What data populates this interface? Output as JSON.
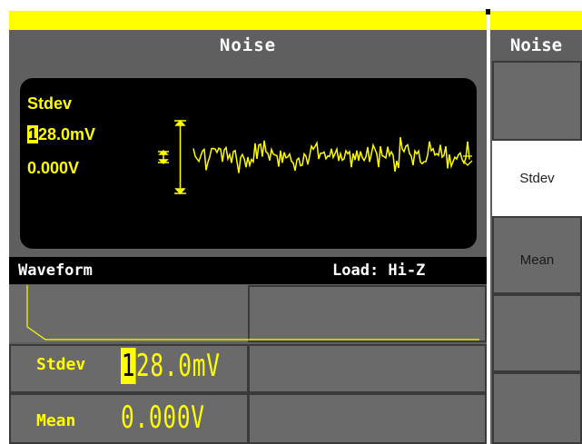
{
  "screen": {
    "title": "Noise"
  },
  "display": {
    "stdev_label": "Stdev",
    "stdev_cursor_digit": "1",
    "stdev_rest": "28.0mV",
    "mean_value": "0.000V"
  },
  "param_header": {
    "waveform_label": "Waveform",
    "load_label": "Load: Hi-Z"
  },
  "params": {
    "stdev_label": "Stdev",
    "stdev_cursor_digit": "1",
    "stdev_rest": "28.0mV",
    "mean_label": "Mean",
    "mean_value": "0.000V"
  },
  "menu": {
    "title": "Noise",
    "items": [
      "",
      "Stdev",
      "Mean",
      "",
      ""
    ],
    "selected": "Stdev"
  },
  "colors": {
    "accent": "#ffff00",
    "panel": "#5f5f5f",
    "display_bg": "#000000"
  }
}
